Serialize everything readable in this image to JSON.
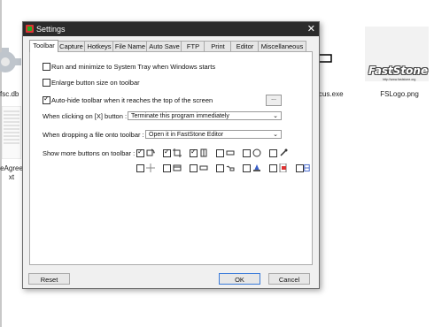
{
  "background": {
    "files": [
      {
        "label": "fsc.db"
      },
      {
        "label": "eAgree\nxt"
      },
      {
        "label": "cus.exe"
      },
      {
        "label": "FSLogo.png"
      }
    ],
    "logo_text": "FastStone",
    "logo_sub": "http://www.faststone.org"
  },
  "dialog": {
    "title": "Settings",
    "tabs": [
      "Toolbar",
      "Capture",
      "Hotkeys",
      "File Name",
      "Auto Save",
      "FTP",
      "Print",
      "Editor",
      "Miscellaneous"
    ],
    "active_tab": "Toolbar",
    "options": {
      "minimize_tray": {
        "label": "Run and minimize to System Tray when Windows starts",
        "checked": false
      },
      "enlarge_buttons": {
        "label": "Enlarge button size on toolbar",
        "checked": false
      },
      "auto_hide": {
        "label": "Auto-hide toolbar when it reaches the top of the screen",
        "checked": true
      }
    },
    "dots_label": "...",
    "close_action": {
      "label": "When clicking on [X] button :",
      "value": "Terminate this program immediately"
    },
    "drop_action": {
      "label": "When dropping a file onto toolbar :",
      "value": "Open it in FastStone Editor"
    },
    "more_buttons_label": "Show more buttons on toolbar :",
    "toolbar_buttons": [
      {
        "icon": "rotate-icon",
        "checked": true
      },
      {
        "icon": "crop-icon",
        "checked": true
      },
      {
        "icon": "film-icon",
        "checked": true
      },
      {
        "icon": "rectangle-icon",
        "checked": false
      },
      {
        "icon": "ellipse-icon",
        "checked": false
      },
      {
        "icon": "eyedropper-icon",
        "checked": false
      },
      {
        "icon": "crosshair-icon",
        "checked": false
      },
      {
        "icon": "window-icon",
        "checked": false
      },
      {
        "icon": "menu-icon",
        "checked": false
      },
      {
        "icon": "hand-icon",
        "checked": false
      },
      {
        "icon": "scanner-icon",
        "checked": false
      },
      {
        "icon": "pdf-icon",
        "checked": false
      },
      {
        "icon": "scroll-icon",
        "checked": false
      }
    ],
    "buttons": {
      "reset": "Reset",
      "ok": "OK",
      "cancel": "Cancel"
    }
  }
}
